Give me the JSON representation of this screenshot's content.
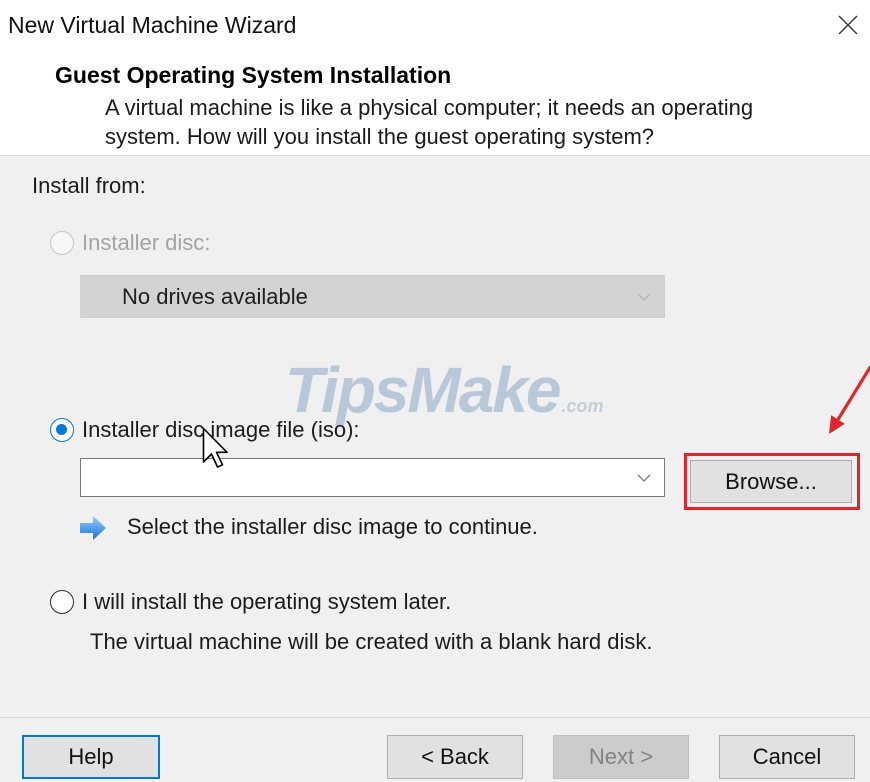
{
  "window": {
    "title": "New Virtual Machine Wizard"
  },
  "header": {
    "title": "Guest Operating System Installation",
    "description_line1": "A virtual machine is like a physical computer; it needs an operating",
    "description_line2": "system. How will you install the guest operating system?"
  },
  "install_from": {
    "label": "Install from:",
    "installer_disc": {
      "label": "Installer disc:",
      "selected": false,
      "enabled": false,
      "drive_dropdown": {
        "value": "No drives available",
        "enabled": false
      }
    },
    "iso_image": {
      "label": "Installer disc image file (iso):",
      "selected": true,
      "enabled": true,
      "path_value": "",
      "browse_label": "Browse...",
      "hint": "Select the installer disc image to continue."
    },
    "install_later": {
      "label": "I will install the operating system later.",
      "selected": false,
      "enabled": true,
      "note": "The virtual machine will be created with a blank hard disk."
    }
  },
  "footer": {
    "help_label": "Help",
    "back_label": "< Back",
    "next_label": "Next >",
    "next_enabled": false,
    "cancel_label": "Cancel"
  },
  "watermark": {
    "brand": "TipsMake",
    "suffix": ".com"
  },
  "icons": {
    "close": "close-icon",
    "dropdown": "chevron-down-icon",
    "hint": "arrow-right-icon",
    "cursor": "mouse-pointer-icon"
  },
  "colors": {
    "accent": "#0078d7",
    "annotation": "#e3242b",
    "disabled_text": "#a3a3a3",
    "panel_background": "#f0f0f0"
  }
}
